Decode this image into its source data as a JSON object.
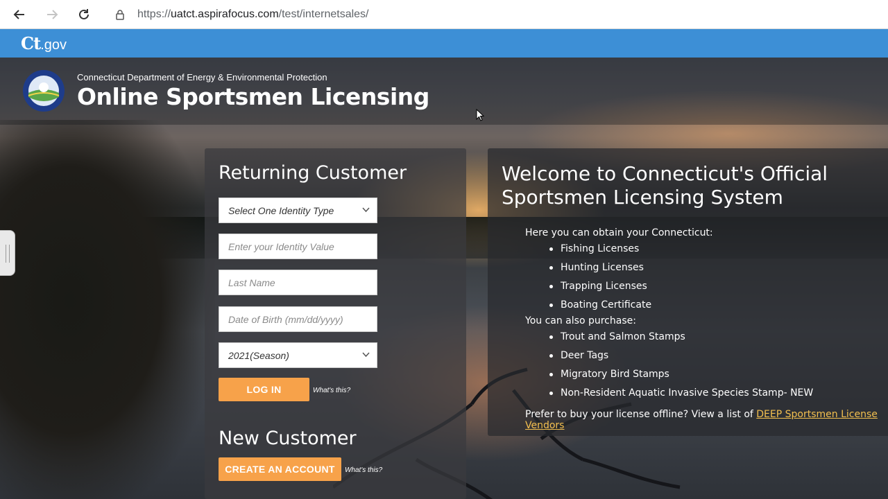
{
  "browser": {
    "url_prefix": "https://",
    "url_domain": "uatct.aspirafocus.com",
    "url_path": "/test/internetsales/",
    "back_icon": "arrow-left-icon",
    "forward_icon": "arrow-right-icon",
    "reload_icon": "reload-icon",
    "lock_icon": "lock-icon"
  },
  "ctgov": {
    "logo_ct": "Ct",
    "logo_gov": ".gov"
  },
  "header": {
    "dept_name": "Connecticut Department of Energy & Environmental Protection",
    "title": "Online Sportsmen Licensing",
    "seal_icon": "ct-deep-seal-icon"
  },
  "returning": {
    "heading": "Returning Customer",
    "identity_type": "Select One Identity Type",
    "identity_value_placeholder": "Enter your Identity Value",
    "last_name_placeholder": "Last Name",
    "dob_placeholder": "Date of Birth (mm/dd/yyyy)",
    "season": "2021(Season)",
    "login_label": "LOG IN",
    "whats_this": "What's this?"
  },
  "new_customer": {
    "heading": "New Customer",
    "create_label": "CREATE AN ACCOUNT",
    "whats_this": "What's this?"
  },
  "welcome": {
    "title": "Welcome to Connecticut's Official Sportsmen Licensing System",
    "obtain_intro": "Here you can obtain your Connecticut:",
    "obtain_items": [
      "Fishing Licenses",
      "Hunting Licenses",
      "Trapping Licenses",
      "Boating Certificate"
    ],
    "purchase_intro": "You can also purchase:",
    "purchase_items": [
      "Trout and Salmon Stamps",
      "Deer Tags",
      "Migratory Bird Stamps",
      "Non-Resident Aquatic Invasive Species Stamp- NEW"
    ],
    "offline_text": "Prefer to buy your license offline? View a list of ",
    "vendor_link": "DEEP Sportsmen License Vendors"
  },
  "colors": {
    "ctgov_blue": "#3d8fd6",
    "button_orange": "#f7a24a",
    "link_yellow": "#f4c04f"
  }
}
